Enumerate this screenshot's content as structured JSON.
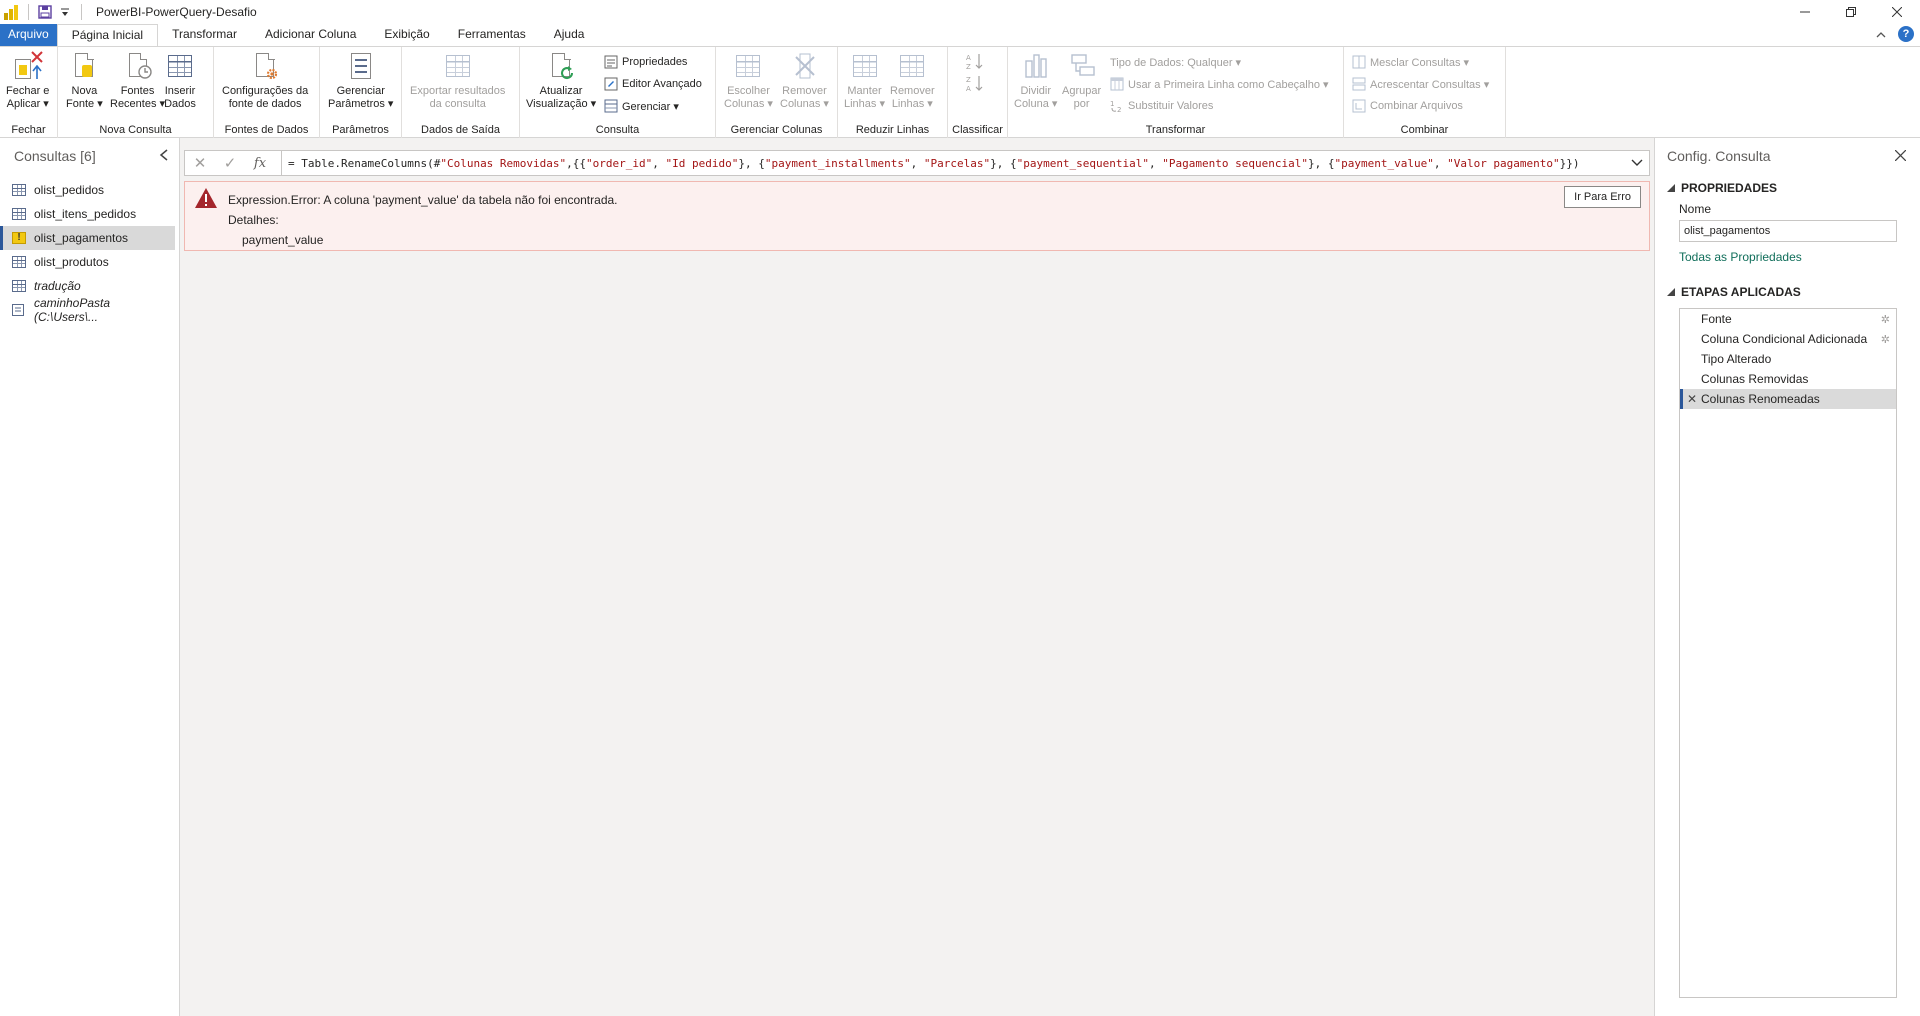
{
  "window": {
    "title": "PowerBI-PowerQuery-Desafio"
  },
  "tabs": [
    "Arquivo",
    "Página Inicial",
    "Transformar",
    "Adicionar Coluna",
    "Exibição",
    "Ferramentas",
    "Ajuda"
  ],
  "ribbon": {
    "fechar": {
      "apply_btn": [
        "Fechar e",
        "Aplicar"
      ],
      "label": "Fechar"
    },
    "nova_consulta": {
      "nova_fonte": [
        "Nova",
        "Fonte"
      ],
      "fontes_recentes": [
        "Fontes",
        "Recentes"
      ],
      "inserir_dados": [
        "Inserir",
        "Dados"
      ],
      "label": "Nova Consulta"
    },
    "fontes_dados": {
      "config": [
        "Configurações da",
        "fonte de dados"
      ],
      "label": "Fontes de Dados"
    },
    "parametros": {
      "gerenciar": [
        "Gerenciar",
        "Parâmetros"
      ],
      "label": "Parâmetros"
    },
    "dados_saida": {
      "exportar": [
        "Exportar resultados",
        "da consulta"
      ],
      "label": "Dados de Saída"
    },
    "consulta": {
      "atualizar": [
        "Atualizar",
        "Visualização"
      ],
      "propriedades": "Propriedades",
      "editor_avancado": "Editor Avançado",
      "gerenciar": "Gerenciar",
      "label": "Consulta"
    },
    "gerenciar_colunas": {
      "escolher": [
        "Escolher",
        "Colunas"
      ],
      "remover": [
        "Remover",
        "Colunas"
      ],
      "label": "Gerenciar Colunas"
    },
    "reduzir_linhas": {
      "manter": [
        "Manter",
        "Linhas"
      ],
      "remover": [
        "Remover",
        "Linhas"
      ],
      "label": "Reduzir Linhas"
    },
    "classificar": {
      "label": "Classificar"
    },
    "transformar": {
      "dividir": [
        "Dividir",
        "Coluna"
      ],
      "agrupar": [
        "Agrupar",
        "por"
      ],
      "tipo_dados": "Tipo de Dados: Qualquer",
      "primeira_linha": "Usar a Primeira Linha como Cabeçalho",
      "substituir": "Substituir Valores",
      "label": "Transformar"
    },
    "combinar": {
      "mesclar": "Mesclar Consultas",
      "acrescentar": "Acrescentar Consultas",
      "combinar_arquivos": "Combinar Arquivos",
      "label": "Combinar"
    }
  },
  "queries": {
    "header": "Consultas [6]",
    "items": [
      {
        "label": "olist_pedidos",
        "icon": "table-icon"
      },
      {
        "label": "olist_itens_pedidos",
        "icon": "table-icon"
      },
      {
        "label": "olist_pagamentos",
        "icon": "warning-icon"
      },
      {
        "label": "olist_produtos",
        "icon": "table-icon"
      },
      {
        "label": "tradução",
        "icon": "table-icon"
      },
      {
        "label": "caminhoPasta (C:\\Users\\...",
        "icon": "parameter-icon"
      }
    ]
  },
  "formula": {
    "prefix": "= Table.RenameColumns(#",
    "parts": [
      [
        "Colunas Removidas",
        true
      ],
      [
        ",{{",
        false
      ],
      [
        "order_id",
        true
      ],
      [
        ", ",
        false
      ],
      [
        "Id pedido",
        true
      ],
      [
        "}, {",
        false
      ],
      [
        "payment_installments",
        true
      ],
      [
        ", ",
        false
      ],
      [
        "Parcelas",
        true
      ],
      [
        "}, {",
        false
      ],
      [
        "payment_sequential",
        true
      ],
      [
        ", ",
        false
      ],
      [
        "Pagamento sequencial",
        true
      ],
      [
        "}, {",
        false
      ],
      [
        "payment_value",
        true
      ],
      [
        ", ",
        false
      ],
      [
        "Valor pagamento",
        true
      ],
      [
        "}})",
        false
      ]
    ]
  },
  "error": {
    "message": "Expression.Error: A coluna 'payment_value' da tabela não foi encontrada.",
    "details_label": "Detalhes:",
    "details_value": "payment_value",
    "goto_button": "Ir Para Erro"
  },
  "settings": {
    "header": "Config. Consulta",
    "properties_title": "PROPRIEDADES",
    "name_label": "Nome",
    "name_value": "olist_pagamentos",
    "all_properties_link": "Todas as Propriedades",
    "steps_title": "ETAPAS APLICADAS",
    "steps": [
      {
        "label": "Fonte",
        "gear": true
      },
      {
        "label": "Coluna Condicional Adicionada",
        "gear": true
      },
      {
        "label": "Tipo Alterado",
        "gear": false
      },
      {
        "label": "Colunas Removidas",
        "gear": false
      },
      {
        "label": "Colunas Renomeadas",
        "gear": false
      }
    ]
  }
}
